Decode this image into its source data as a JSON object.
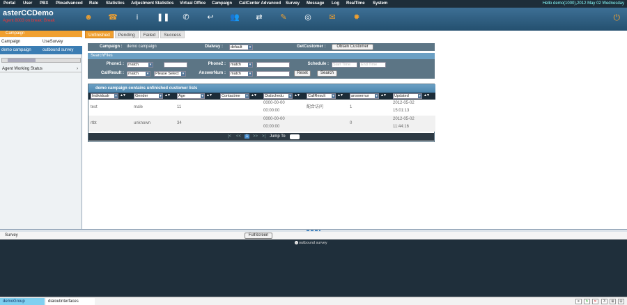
{
  "topmenu": {
    "items": [
      "Portal",
      "User",
      "PBX",
      "Pbxadvanced",
      "Rate",
      "Statistics",
      "Adjustment Statistics",
      "Virtual Office",
      "Campaign",
      "CallCenter Advanced",
      "Survey",
      "Message",
      "Log",
      "RealTime",
      "System"
    ],
    "hello": "Hello demo(1000),2012 May 02 Wednesday"
  },
  "header": {
    "app_name": "asterCCDemo",
    "subtitle": "Agent 8003 on break: Break"
  },
  "left": {
    "campaign_header": "Campaign",
    "columns": [
      "Campaign",
      "UseSurvey"
    ],
    "rows": [
      [
        "demo campaign",
        "outbound survey"
      ]
    ],
    "agent_status": "Agent Working Status"
  },
  "tabs": [
    "Unfinished",
    "Pending",
    "Failed",
    "Success"
  ],
  "config": {
    "campaign_label": "Campaign :",
    "campaign_value": "demo campaign",
    "dialway_label": "Dialway :",
    "dialway_value": "default",
    "getcustomer_label": "GetCustomer :",
    "obtain_button": "Obtain Customer"
  },
  "search": {
    "header": "SearchFiles",
    "phone1_label": "Phone1 :",
    "phone1_op": "match",
    "phone2_label": "Phone2 :",
    "phone2_op": "match",
    "schedule_label": "Schedule :",
    "start_placeholder": "Start Time",
    "end_placeholder": "End Time",
    "callresult_label": "CallResult :",
    "callresult_op": "match",
    "callresult_value": "Please Select",
    "answernum_label": "AnswerNum :",
    "answernum_op": "match",
    "reset_button": "Reset",
    "search_button": "Search"
  },
  "list": {
    "title": "demo campaign contains unfinished customer lists",
    "columns": [
      "Individualr",
      "Gender",
      "Age",
      "Contactme",
      "Dialschedu",
      "CallResult",
      "answernur",
      "Updated"
    ],
    "rows": [
      {
        "name": "test",
        "gender": "male",
        "age": "11",
        "contact": "",
        "dial1": "0000-00-00",
        "dial2": "00:00:00",
        "result": "配合访问",
        "answer": "1",
        "upd1": "2012-05-02",
        "upd2": "15:01:13"
      },
      {
        "name": "rtbt",
        "gender": "unknown",
        "age": "34",
        "contact": "",
        "dial1": "0000-00-00",
        "dial2": "00:00:00",
        "result": "",
        "answer": "0",
        "upd1": "2012-05-02",
        "upd2": "11:44:16"
      }
    ],
    "pager": {
      "first": "|<",
      "prev": "<<",
      "current": "1",
      "next": ">>",
      "last": ">|",
      "jump_label": "Jump To"
    }
  },
  "bottom": {
    "survey_label": "Survey",
    "fullscreen_button": "FullScreen",
    "survey_item": "outbound survey"
  },
  "footer": {
    "tab1": "demoGroup",
    "tab2": "dialoutinterfaces",
    "icons": [
      "≡",
      "↻",
      "✕",
      "3",
      "⊞",
      "⊟"
    ]
  }
}
